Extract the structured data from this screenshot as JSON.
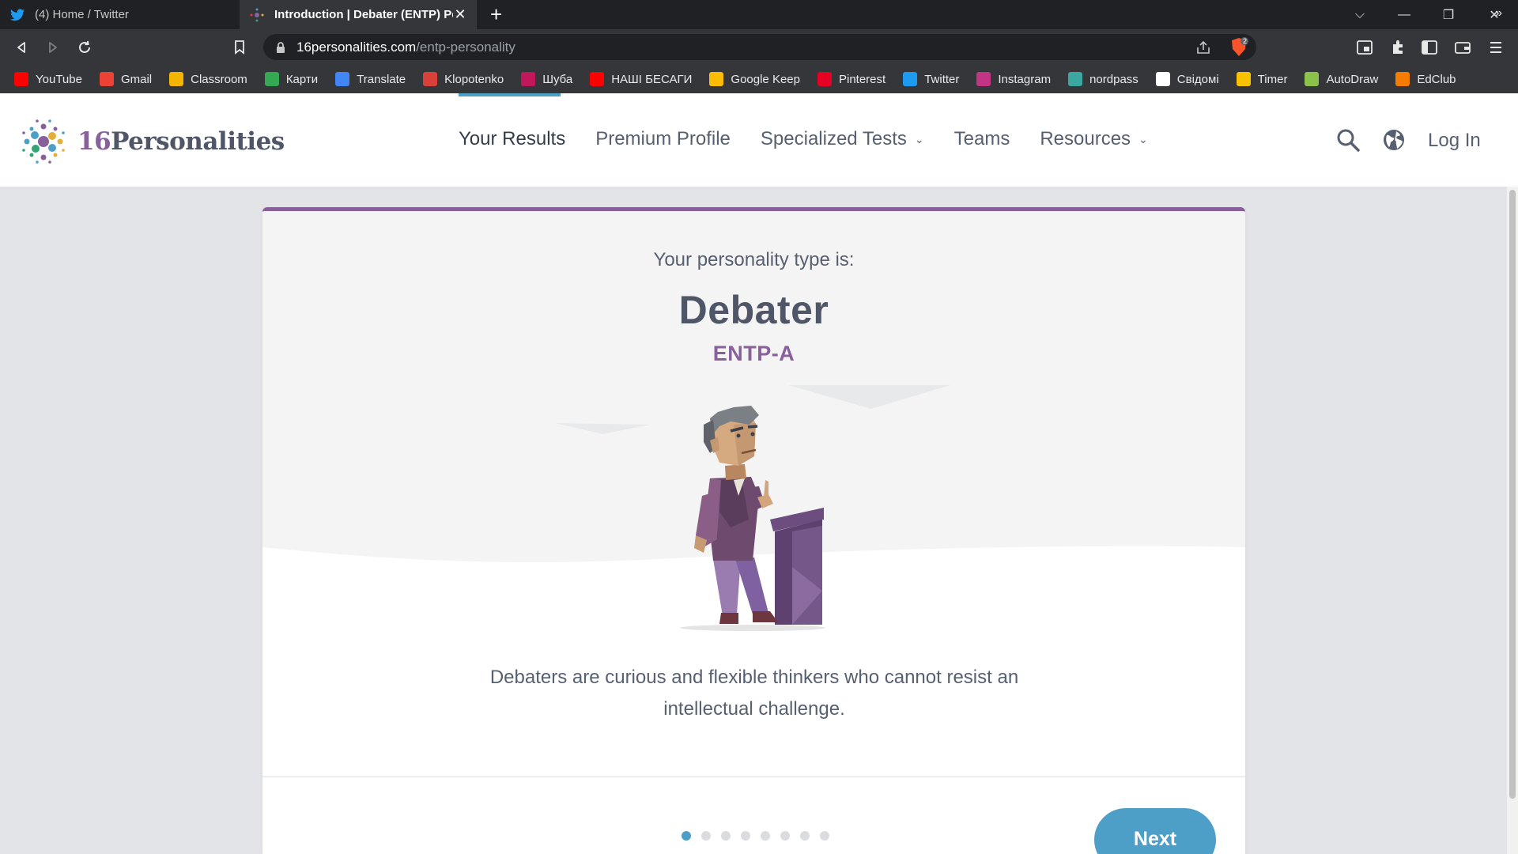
{
  "browser": {
    "tabs": [
      {
        "title": "(4) Home / Twitter",
        "active": false
      },
      {
        "title": "Introduction | Debater (ENTP) Per",
        "active": true
      }
    ],
    "new_tab_label": "+",
    "url_host": "16personalities.com",
    "url_path": "/entp-personality",
    "shield_badge": "2",
    "bookmarks": [
      {
        "label": "YouTube",
        "icon": "youtube-icon",
        "color": "#ff0000"
      },
      {
        "label": "Gmail",
        "icon": "gmail-icon",
        "color": "#ea4335"
      },
      {
        "label": "Classroom",
        "icon": "classroom-icon",
        "color": "#f4b400"
      },
      {
        "label": "Карти",
        "icon": "maps-icon",
        "color": "#34a853"
      },
      {
        "label": "Translate",
        "icon": "translate-icon",
        "color": "#4285f4"
      },
      {
        "label": "Klopotenko",
        "icon": "klopotenko-icon",
        "color": "#d9403a"
      },
      {
        "label": "Шуба",
        "icon": "shuba-icon",
        "color": "#c2185b"
      },
      {
        "label": "НАШІ БЕСАГИ",
        "icon": "youtube-icon",
        "color": "#ff0000"
      },
      {
        "label": "Google Keep",
        "icon": "keep-icon",
        "color": "#fbbc04"
      },
      {
        "label": "Pinterest",
        "icon": "pinterest-icon",
        "color": "#e60023"
      },
      {
        "label": "Twitter",
        "icon": "twitter-icon",
        "color": "#1d9bf0"
      },
      {
        "label": "Instagram",
        "icon": "instagram-icon",
        "color": "#c13584"
      },
      {
        "label": "nordpass",
        "icon": "nordpass-icon",
        "color": "#3ba7a0"
      },
      {
        "label": "Свідомі",
        "icon": "svidomi-icon",
        "color": "#ffffff"
      },
      {
        "label": "Timer",
        "icon": "timer-icon",
        "color": "#f9c200"
      },
      {
        "label": "AutoDraw",
        "icon": "autodraw-icon",
        "color": "#8bc34a"
      },
      {
        "label": "EdClub",
        "icon": "edclub-icon",
        "color": "#f57c00"
      }
    ],
    "bookmarks_more": "»"
  },
  "site": {
    "logo": {
      "number": "16",
      "word": "Personalities"
    },
    "nav": [
      {
        "label": "Your Results",
        "active": true,
        "dropdown": false
      },
      {
        "label": "Premium Profile",
        "active": false,
        "dropdown": false
      },
      {
        "label": "Specialized Tests",
        "active": false,
        "dropdown": true
      },
      {
        "label": "Teams",
        "active": false,
        "dropdown": false
      },
      {
        "label": "Resources",
        "active": false,
        "dropdown": true
      }
    ],
    "login_label": "Log In",
    "accent_color": "#88619a",
    "primary_color": "#4d9fc7"
  },
  "result": {
    "intro": "Your personality type is:",
    "type_name": "Debater",
    "type_code": "ENTP-A",
    "description": "Debaters are curious and flexible thinkers who cannot resist an intellectual challenge.",
    "pagination": {
      "total": 8,
      "current": 1
    },
    "next_label": "Next"
  }
}
